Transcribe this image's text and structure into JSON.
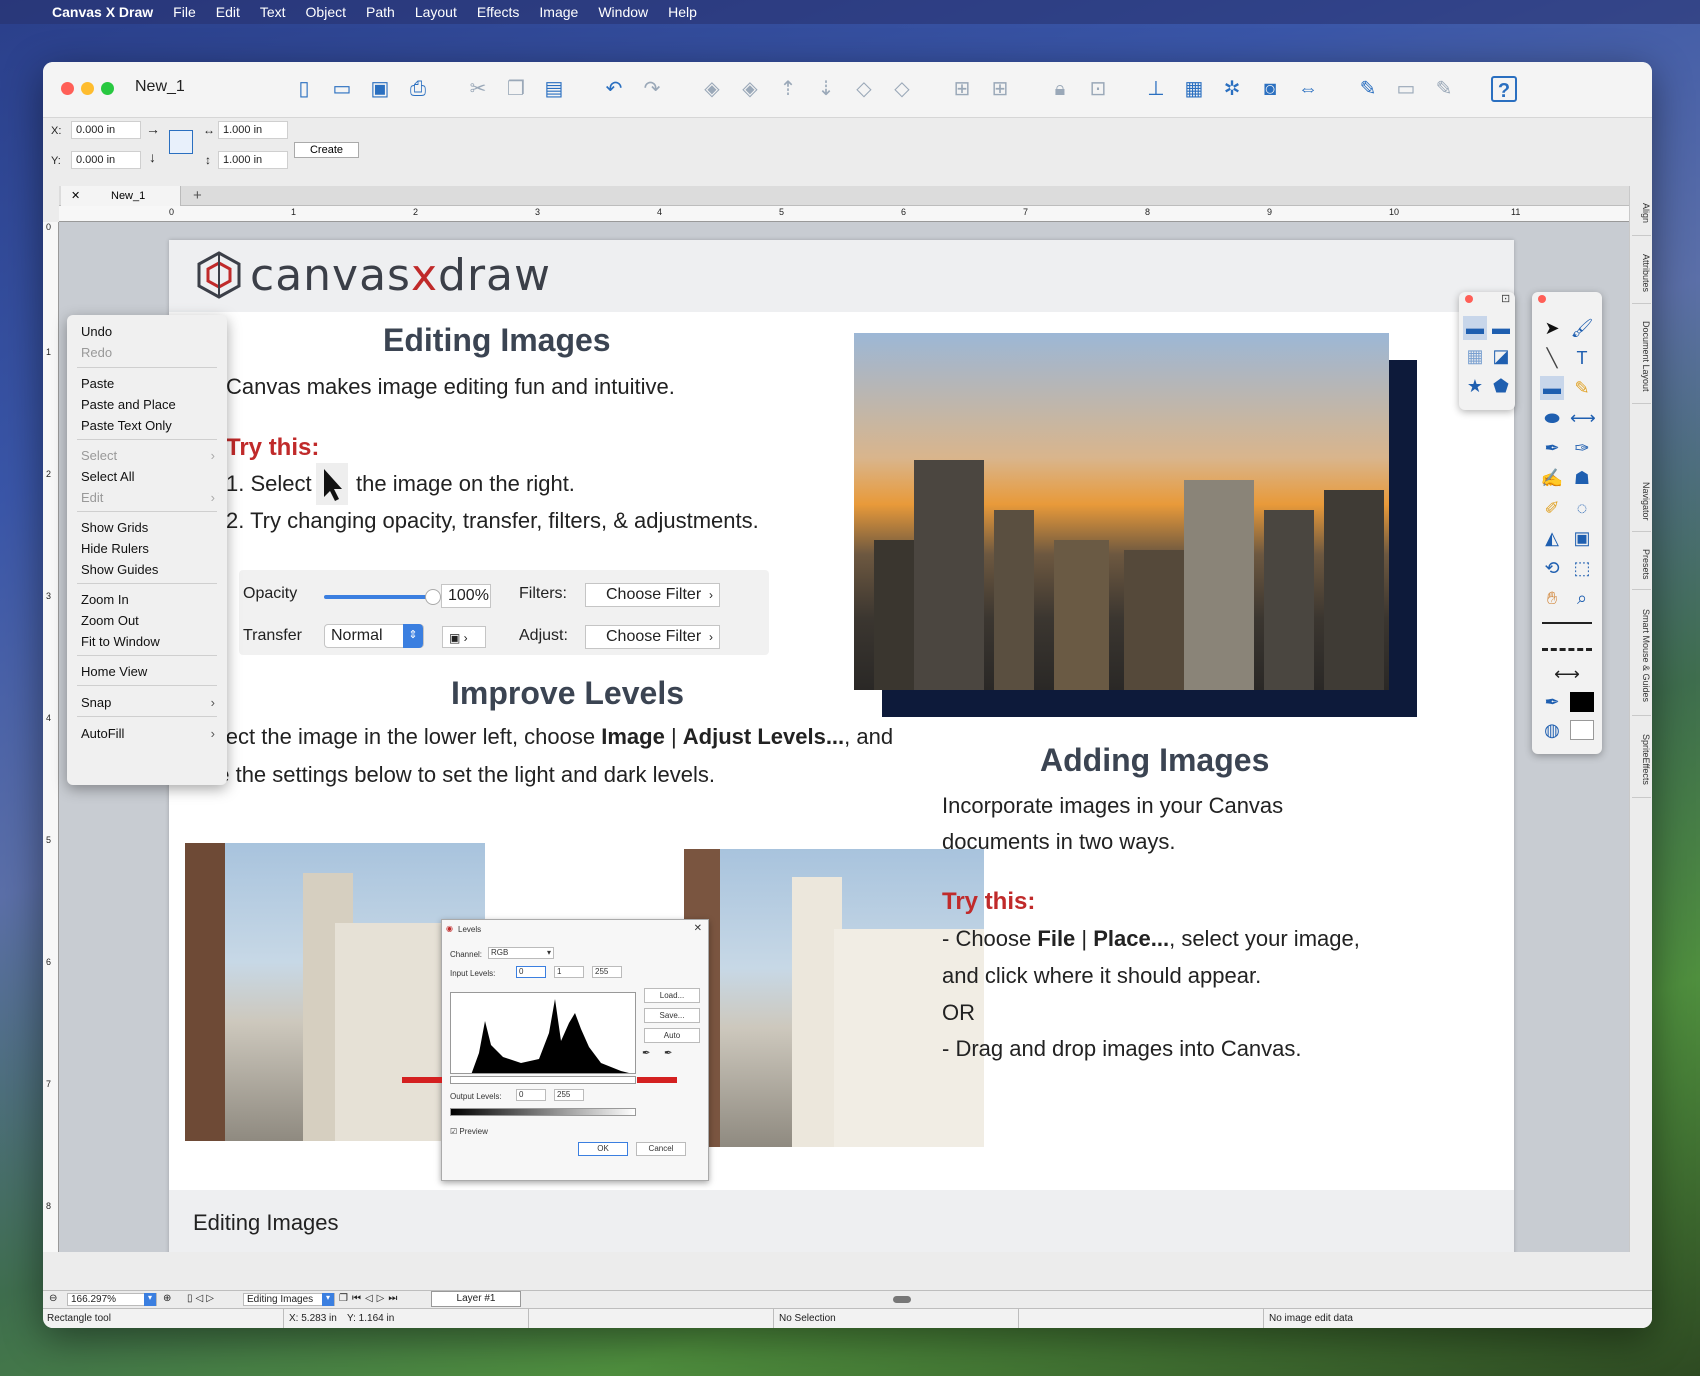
{
  "menubar": {
    "app": "Canvas X Draw",
    "items": [
      "File",
      "Edit",
      "Text",
      "Object",
      "Path",
      "Layout",
      "Effects",
      "Image",
      "Window",
      "Help"
    ]
  },
  "window": {
    "title": "New_1",
    "doc_tab": "New_1"
  },
  "propbar": {
    "x_label": "X:",
    "x_value": "0.000 in",
    "y_label": "Y:",
    "y_value": "0.000 in",
    "w_value": "1.000 in",
    "h_value": "1.000 in",
    "create": "Create"
  },
  "ruler": {
    "h_ticks": [
      "0",
      "1",
      "2",
      "3",
      "4",
      "5",
      "6",
      "7",
      "8",
      "9",
      "10",
      "11"
    ],
    "v_ticks": [
      "0",
      "1",
      "2",
      "3",
      "4",
      "5",
      "6",
      "7",
      "8"
    ]
  },
  "page": {
    "logo_left": "canvas",
    "logo_x": "x",
    "logo_right": "draw",
    "sec1_title": "Editing Images",
    "sec1_intro": "Canvas makes image editing fun and intuitive.",
    "try1": "Try this:",
    "step1a": "1. Select",
    "step1b": "the image on the right.",
    "step2": "2. Try changing opacity, transfer, filters, & adjustments.",
    "opacity_label": "Opacity",
    "opacity_value": "100%",
    "transfer_label": "Transfer",
    "transfer_value": "Normal",
    "filters_label": "Filters:",
    "filters_value": "Choose Filter",
    "adjust_label": "Adjust:",
    "adjust_value": "Choose Filter",
    "sec2_title": "Improve Levels",
    "sec2_line1a": "Select the image in the lower left, choose ",
    "sec2_line1b": "Image",
    "sec2_line1c": " | ",
    "sec2_line1d": "Adjust Levels...",
    "sec2_line1e": ", and",
    "sec2_line2": "use the settings below to set the light and dark levels.",
    "sec3_title": "Adding Images",
    "sec3_line1": "Incorporate images in your Canvas",
    "sec3_line2": "documents in two ways.",
    "try2": "Try this:",
    "sec3_b1a": "- Choose ",
    "sec3_b1b": "File",
    "sec3_b1c": " | ",
    "sec3_b1d": "Place...",
    "sec3_b1e": ", select your image,",
    "sec3_b1f": "and click where it should appear.",
    "sec3_or": "OR",
    "sec3_b2": "- Drag and drop images into Canvas.",
    "footer": "Editing Images"
  },
  "levels_dialog": {
    "title": "Levels",
    "channel_label": "Channel:",
    "channel_value": "RGB",
    "input_label": "Input Levels:",
    "input_values": [
      "0",
      "1",
      "255"
    ],
    "output_label": "Output Levels:",
    "output_values": [
      "0",
      "255"
    ],
    "load": "Load...",
    "save": "Save...",
    "auto": "Auto",
    "preview": "Preview",
    "ok": "OK",
    "cancel": "Cancel"
  },
  "context_menu": {
    "undo": "Undo",
    "redo": "Redo",
    "paste": "Paste",
    "paste_place": "Paste and Place",
    "paste_text": "Paste Text Only",
    "select": "Select",
    "select_all": "Select All",
    "edit": "Edit",
    "show_grids": "Show Grids",
    "hide_rulers": "Hide Rulers",
    "show_guides": "Show Guides",
    "zoom_in": "Zoom In",
    "zoom_out": "Zoom Out",
    "fit_window": "Fit to Window",
    "home_view": "Home View",
    "snap": "Snap",
    "autofill": "AutoFill"
  },
  "sidetabs": [
    "Align",
    "Attributes",
    "Document Layout",
    "Navigator",
    "Presets",
    "Smart Mouse & Guides",
    "SpriteEffects"
  ],
  "bottombar": {
    "zoom": "166.297%",
    "page_name": "Editing Images",
    "layer": "Layer #1"
  },
  "statusbar": {
    "tool": "Rectangle tool",
    "x": "X: 5.283 in",
    "y": "Y: 1.164 in",
    "selection": "No Selection",
    "image_edit": "No image edit data"
  },
  "colors": {
    "accent": "#2a6fc0",
    "heading": "#3b4452",
    "try_red": "#c02a2a"
  }
}
